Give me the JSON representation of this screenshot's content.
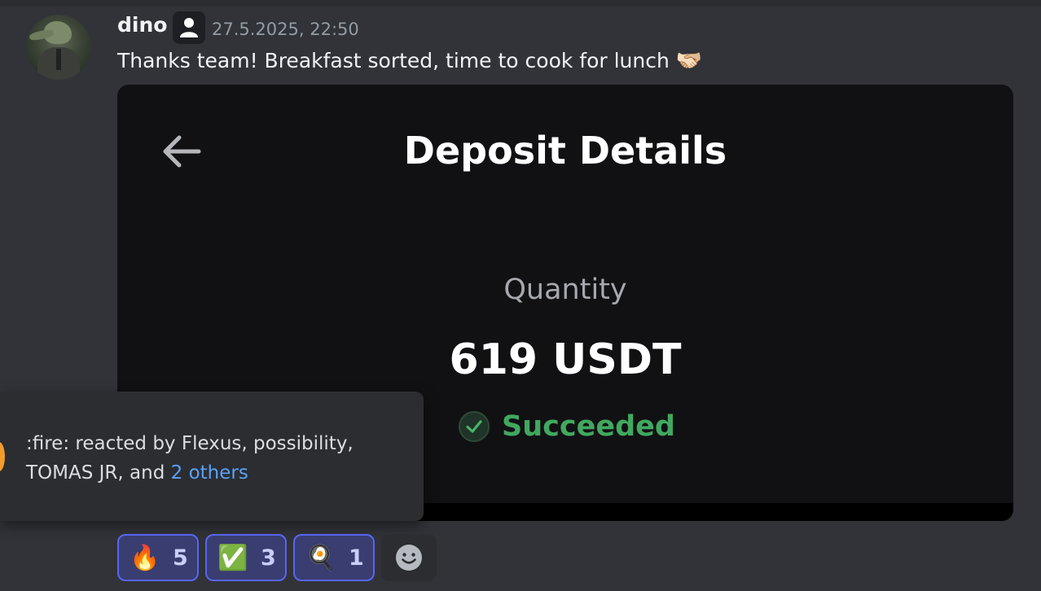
{
  "message": {
    "username": "dino",
    "timestamp": "27.5.2025, 22:50",
    "text": "Thanks team! Breakfast sorted, time to cook for lunch",
    "text_emoji": "🫱🏻‍🫲🏼"
  },
  "embed": {
    "title": "Deposit Details",
    "quantity_label": "Quantity",
    "quantity_value": "619 USDT",
    "status": "Succeeded"
  },
  "tooltip": {
    "line1": ":fire: reacted by Flexus, possibility,",
    "line2_prefix": "TOMAS JR, and ",
    "link": "2 others"
  },
  "reactions": [
    {
      "emoji": "🔥",
      "count": "5",
      "icon": "fire-emoji"
    },
    {
      "emoji": "✅",
      "count": "3",
      "icon": "check-mark-emoji"
    },
    {
      "emoji": "🍳",
      "count": "1",
      "icon": "frying-pan-emoji"
    }
  ],
  "icons": {
    "avatar": "crocodile-in-suit-avatar",
    "role_badge": "person-icon",
    "back": "back-arrow-icon",
    "status": "check-circle-icon",
    "add_reaction": "smiley-add-reaction-icon"
  },
  "colors": {
    "background": "#313338",
    "embed_bg": "#111114",
    "succeeded": "#41a85f",
    "link": "#5ba1f7",
    "reaction_border": "#5865f2"
  }
}
